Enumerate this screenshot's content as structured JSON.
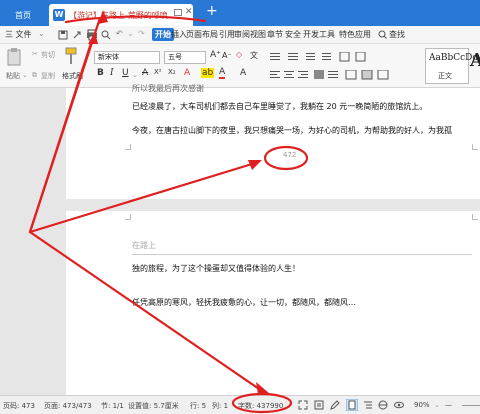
{
  "titlebar": {
    "home_tab": "首页",
    "doc_tab_badge": "W",
    "doc_tab_title": "【游记】在路上-荒野的呼唤",
    "add_tab": "+"
  },
  "menubar": {
    "file": "三 文件",
    "start": "开始",
    "tabs": [
      "插入",
      "页面布局",
      "引用",
      "审阅",
      "视图",
      "章节",
      "安全",
      "开发工具",
      "特色应用"
    ],
    "search": "查找"
  },
  "ribbon": {
    "paste": "粘贴",
    "cut": "剪切",
    "copy": "复制",
    "format_painter": "格式刷",
    "font_name": "新宋体",
    "font_size": "五号",
    "bold": "B",
    "italic": "I",
    "underline": "U",
    "style_sample": "AaBbCcDd",
    "style_name": "正文",
    "big_a": "A"
  },
  "document": {
    "page1_top_fragment": "所以我最后再次感谢",
    "page1_para1": "已经凌晨了，大车司机们都去自己车里睡觉了，我躺在 20 元一晚简陋的旅馆炕上。",
    "page1_para2": "今夜，在唐古拉山脚下的夜里，我只想痛哭一场，为好心的司机，为帮助我的好人，为我孤",
    "page_number": "472",
    "page2_header": "在路上",
    "page2_para1": "独的旅程，为了这个操蛋却又值得体验的人生！",
    "page2_para2": "任凭高原的寒风，轻抚我疲惫的心，让一切，都随风，都随风…"
  },
  "statusbar": {
    "page_no": "页码: 473",
    "page_total": "页面: 473/473",
    "section": "节: 1/1",
    "setting": "设置值: 5.7厘米",
    "row": "行: 5",
    "col": "列: 1",
    "word_count": "字数: 437990",
    "zoom": "90%",
    "zoom_minus": "—"
  },
  "colors": {
    "titlebar": "#2a78d6",
    "annotation": "#e02020"
  }
}
